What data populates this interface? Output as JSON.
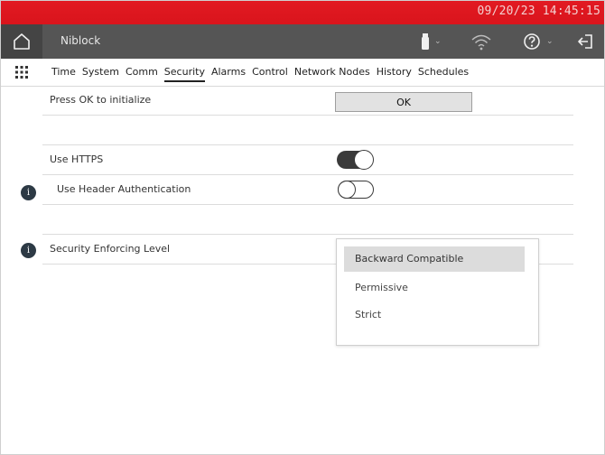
{
  "status_bar": {
    "datetime": "09/20/23 14:45:15",
    "color": "#e21a22"
  },
  "header": {
    "device_name": "Niblock",
    "icons": [
      "home-icon",
      "usb-icon",
      "wifi-icon",
      "help-icon",
      "logout-icon"
    ]
  },
  "nav": {
    "apps_icon": "grid-icon",
    "tabs": [
      {
        "label": "Time",
        "active": false
      },
      {
        "label": "System",
        "active": false
      },
      {
        "label": "Comm",
        "active": false
      },
      {
        "label": "Security",
        "active": true
      },
      {
        "label": "Alarms",
        "active": false
      },
      {
        "label": "Control",
        "active": false
      },
      {
        "label": "Network Nodes",
        "active": false
      },
      {
        "label": "History",
        "active": false
      },
      {
        "label": "Schedules",
        "active": false
      }
    ]
  },
  "security": {
    "initialize_label": "Press OK to initialize",
    "ok_label": "OK",
    "https_label": "Use HTTPS",
    "https_enabled": true,
    "header_auth_label": "Use Header Authentication",
    "header_auth_enabled": false,
    "enforcing_label": "Security Enforcing Level",
    "enforcing_options": [
      {
        "label": "Backward Compatible",
        "selected": true
      },
      {
        "label": "Permissive",
        "selected": false
      },
      {
        "label": "Strict",
        "selected": false
      }
    ]
  }
}
